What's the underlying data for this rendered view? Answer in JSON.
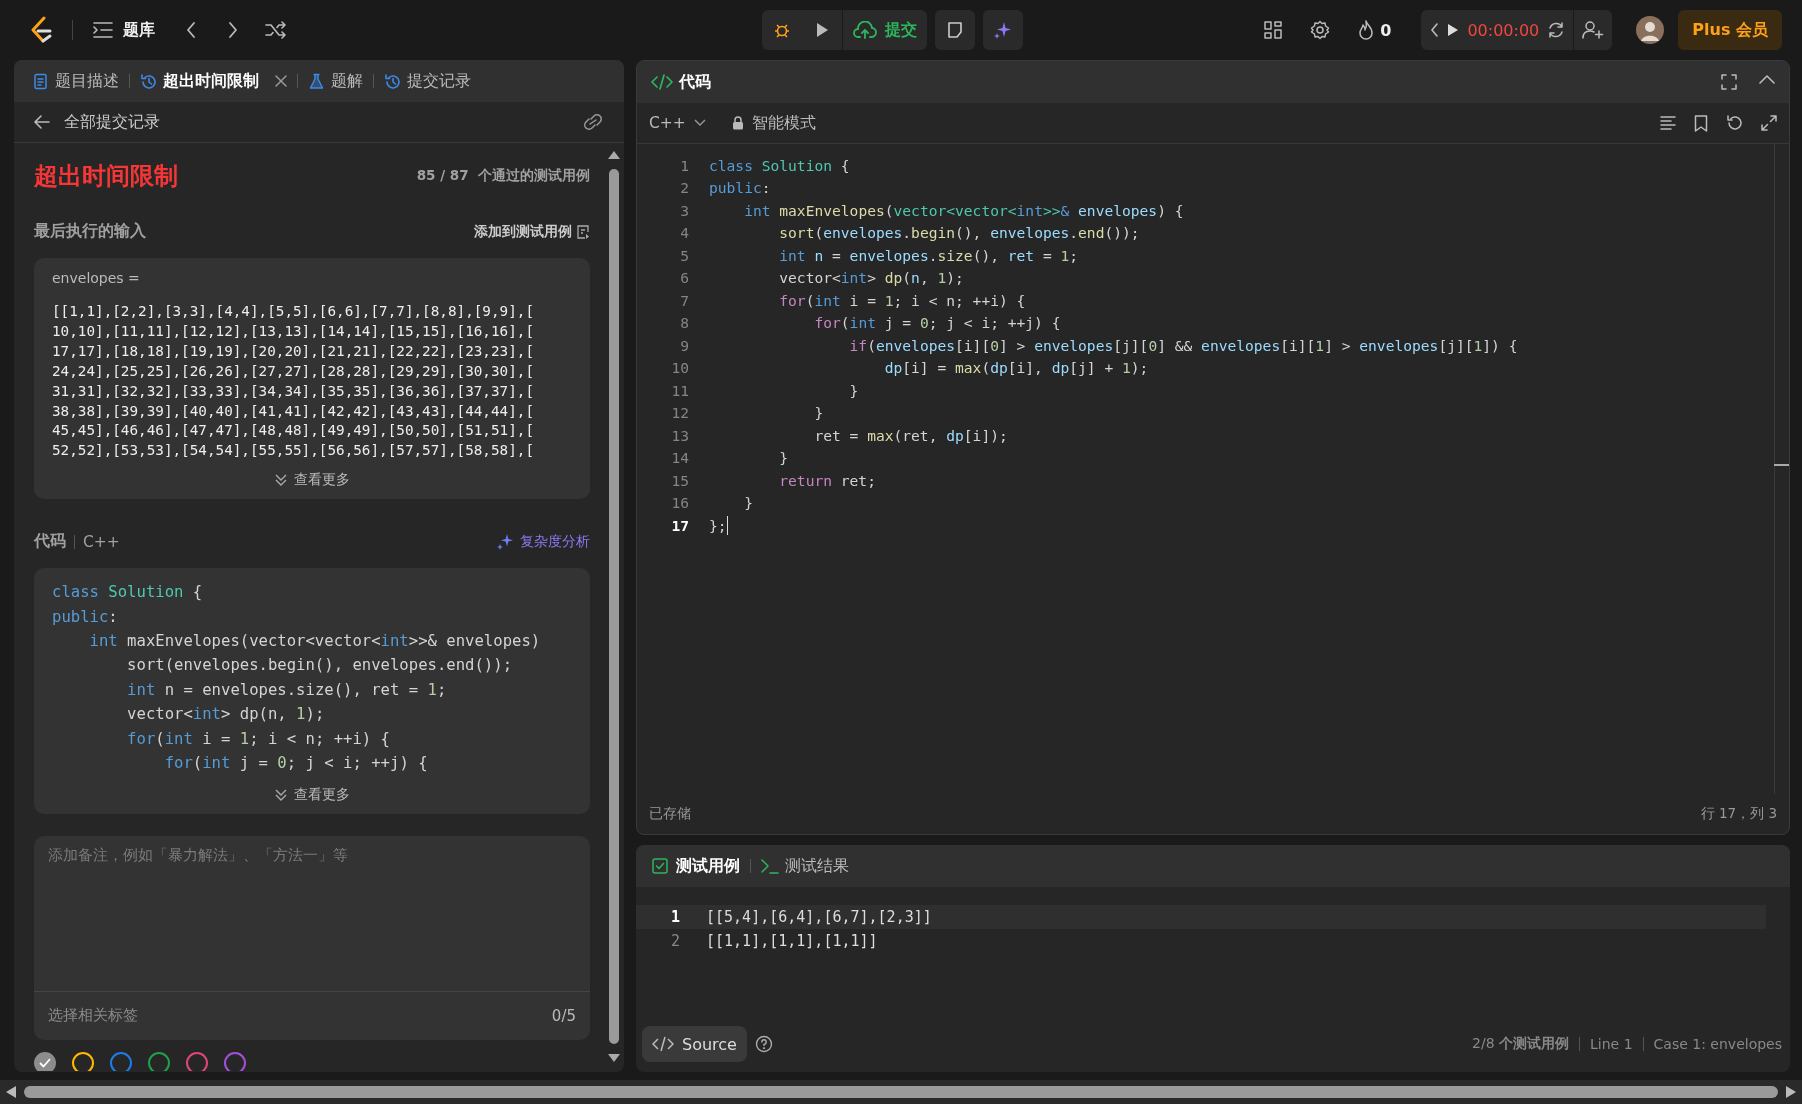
{
  "topbar": {
    "library": "题库",
    "submit": "提交",
    "streak": "0",
    "timer": "00:00:00",
    "plus": "Plus 会员"
  },
  "left_panel": {
    "tabs": [
      {
        "label": "题目描述",
        "kind": "description",
        "selected": false,
        "closable": false
      },
      {
        "label": "超出时间限制",
        "kind": "submission",
        "selected": true,
        "closable": true
      },
      {
        "label": "题解",
        "kind": "solution",
        "selected": false,
        "closable": false
      },
      {
        "label": "提交记录",
        "kind": "history",
        "selected": false,
        "closable": false
      }
    ],
    "back": "全部提交记录",
    "status": "超出时间限制",
    "passed": "85 / 87",
    "passed_label": "个通过的测试用例",
    "last_input_label": "最后执行的输入",
    "add_to_tests": "添加到测试用例",
    "input_name": "envelopes =",
    "input_lines": [
      "[[1,1],[2,2],[3,3],[4,4],[5,5],[6,6],[7,7],[8,8],[9,9],[",
      "10,10],[11,11],[12,12],[13,13],[14,14],[15,15],[16,16],[",
      "17,17],[18,18],[19,19],[20,20],[21,21],[22,22],[23,23],[",
      "24,24],[25,25],[26,26],[27,27],[28,28],[29,29],[30,30],[",
      "31,31],[32,32],[33,33],[34,34],[35,35],[36,36],[37,37],[",
      "38,38],[39,39],[40,40],[41,41],[42,42],[43,43],[44,44],[",
      "45,45],[46,46],[47,47],[48,48],[49,49],[50,50],[51,51],[",
      "52,52],[53,53],[54,54],[55,55],[56,56],[57,57],[58,58],["
    ],
    "show_more": "查看更多",
    "code_label": "代码",
    "code_lang": "C++",
    "complexity": "复杂度分析",
    "code_preview": [
      [
        {
          "kind": "kw",
          "text": "class "
        },
        {
          "kind": "type",
          "text": "Solution"
        },
        {
          "kind": "txt",
          "text": " {"
        }
      ],
      [
        {
          "kind": "kw",
          "text": "public"
        },
        {
          "kind": "txt",
          "text": ":"
        }
      ],
      [
        {
          "kind": "kw",
          "text": "    int"
        },
        {
          "kind": "txt",
          "text": " maxEnvelopes(vector<vector<"
        },
        {
          "kind": "kw",
          "text": "int"
        },
        {
          "kind": "txt",
          "text": ">>& envelopes)"
        }
      ],
      [
        {
          "kind": "txt",
          "text": "        sort(envelopes.begin(), envelopes.end());"
        }
      ],
      [
        {
          "kind": "kw",
          "text": "        int"
        },
        {
          "kind": "txt",
          "text": " n = envelopes.size(), ret = "
        },
        {
          "kind": "num",
          "text": "1"
        },
        {
          "kind": "txt",
          "text": ";"
        }
      ],
      [
        {
          "kind": "txt",
          "text": "        vector<"
        },
        {
          "kind": "kw",
          "text": "int"
        },
        {
          "kind": "txt",
          "text": "> dp(n, "
        },
        {
          "kind": "num",
          "text": "1"
        },
        {
          "kind": "txt",
          "text": ");"
        }
      ],
      [
        {
          "kind": "kw",
          "text": "        for"
        },
        {
          "kind": "txt",
          "text": "("
        },
        {
          "kind": "kw",
          "text": "int"
        },
        {
          "kind": "txt",
          "text": " i = "
        },
        {
          "kind": "num",
          "text": "1"
        },
        {
          "kind": "txt",
          "text": "; i < n; ++i) {"
        }
      ],
      [
        {
          "kind": "kw",
          "text": "            for"
        },
        {
          "kind": "txt",
          "text": "("
        },
        {
          "kind": "kw",
          "text": "int"
        },
        {
          "kind": "txt",
          "text": " j = "
        },
        {
          "kind": "num",
          "text": "0"
        },
        {
          "kind": "txt",
          "text": "; j < i; ++j) {"
        }
      ]
    ],
    "show_more_code": "查看更多",
    "note_placeholder": "添加备注，例如「暴力解法」、「方法一」等",
    "tags_placeholder": "选择相关标签",
    "tags_count": "0/5",
    "colors": [
      {
        "color": "#8c8c8c",
        "selected": true
      },
      {
        "color": "#ffb800",
        "selected": false
      },
      {
        "color": "#1e7ce8",
        "selected": false
      },
      {
        "color": "#1fa14a",
        "selected": false
      },
      {
        "color": "#e0457b",
        "selected": false
      },
      {
        "color": "#a54fd8",
        "selected": false
      }
    ]
  },
  "editor": {
    "title": "代码",
    "language": "C++",
    "mode": "智能模式",
    "lines": [
      {
        "no": "1",
        "current": false,
        "tokens": [
          {
            "kind": "kw",
            "text": "class "
          },
          {
            "kind": "type",
            "text": "Solution"
          },
          {
            "kind": "txt",
            "text": " {"
          }
        ]
      },
      {
        "no": "2",
        "current": false,
        "tokens": [
          {
            "kind": "kw",
            "text": "public"
          },
          {
            "kind": "txt",
            "text": ":"
          }
        ]
      },
      {
        "no": "3",
        "current": false,
        "tokens": [
          {
            "kind": "kw",
            "text": "    int"
          },
          {
            "kind": "fn",
            "text": " maxEnvelopes"
          },
          {
            "kind": "txt",
            "text": "("
          },
          {
            "kind": "type",
            "text": "vector<vector<"
          },
          {
            "kind": "kw",
            "text": "int"
          },
          {
            "kind": "type",
            "text": ">>"
          },
          {
            "kind": "kw",
            "text": "& "
          },
          {
            "kind": "var",
            "text": "envelopes"
          },
          {
            "kind": "txt",
            "text": ") {"
          }
        ]
      },
      {
        "no": "4",
        "current": false,
        "tokens": [
          {
            "kind": "fn",
            "text": "        sort"
          },
          {
            "kind": "txt",
            "text": "("
          },
          {
            "kind": "var",
            "text": "envelopes"
          },
          {
            "kind": "txt",
            "text": "."
          },
          {
            "kind": "fn",
            "text": "begin"
          },
          {
            "kind": "txt",
            "text": "(), "
          },
          {
            "kind": "var",
            "text": "envelopes"
          },
          {
            "kind": "txt",
            "text": "."
          },
          {
            "kind": "fn",
            "text": "end"
          },
          {
            "kind": "txt",
            "text": "());"
          }
        ]
      },
      {
        "no": "5",
        "current": false,
        "tokens": [
          {
            "kind": "kw",
            "text": "        int"
          },
          {
            "kind": "var",
            "text": " n"
          },
          {
            "kind": "txt",
            "text": " = "
          },
          {
            "kind": "var",
            "text": "envelopes"
          },
          {
            "kind": "txt",
            "text": "."
          },
          {
            "kind": "fn",
            "text": "size"
          },
          {
            "kind": "txt",
            "text": "(), "
          },
          {
            "kind": "var",
            "text": "ret"
          },
          {
            "kind": "txt",
            "text": " = "
          },
          {
            "kind": "num",
            "text": "1"
          },
          {
            "kind": "txt",
            "text": ";"
          }
        ]
      },
      {
        "no": "6",
        "current": false,
        "tokens": [
          {
            "kind": "txt",
            "text": "        vector<"
          },
          {
            "kind": "kw",
            "text": "int"
          },
          {
            "kind": "txt",
            "text": "> "
          },
          {
            "kind": "fn",
            "text": "dp"
          },
          {
            "kind": "txt",
            "text": "("
          },
          {
            "kind": "var",
            "text": "n"
          },
          {
            "kind": "txt",
            "text": ", "
          },
          {
            "kind": "num",
            "text": "1"
          },
          {
            "kind": "txt",
            "text": ");"
          }
        ]
      },
      {
        "no": "7",
        "current": false,
        "tokens": [
          {
            "kind": "ctl",
            "text": "        for"
          },
          {
            "kind": "txt",
            "text": "("
          },
          {
            "kind": "kw",
            "text": "int"
          },
          {
            "kind": "txt",
            "text": " i = "
          },
          {
            "kind": "num",
            "text": "1"
          },
          {
            "kind": "txt",
            "text": "; i < n; ++i) {"
          }
        ]
      },
      {
        "no": "8",
        "current": false,
        "tokens": [
          {
            "kind": "ctl",
            "text": "            for"
          },
          {
            "kind": "txt",
            "text": "("
          },
          {
            "kind": "kw",
            "text": "int"
          },
          {
            "kind": "txt",
            "text": " j = "
          },
          {
            "kind": "num",
            "text": "0"
          },
          {
            "kind": "txt",
            "text": "; j < i; ++j) {"
          }
        ]
      },
      {
        "no": "9",
        "current": false,
        "tokens": [
          {
            "kind": "ctl",
            "text": "                if"
          },
          {
            "kind": "txt",
            "text": "("
          },
          {
            "kind": "var",
            "text": "envelopes"
          },
          {
            "kind": "txt",
            "text": "[i]["
          },
          {
            "kind": "num",
            "text": "0"
          },
          {
            "kind": "txt",
            "text": "] > "
          },
          {
            "kind": "var",
            "text": "envelopes"
          },
          {
            "kind": "txt",
            "text": "[j]["
          },
          {
            "kind": "num",
            "text": "0"
          },
          {
            "kind": "txt",
            "text": "] && "
          },
          {
            "kind": "var",
            "text": "envelopes"
          },
          {
            "kind": "txt",
            "text": "[i]["
          },
          {
            "kind": "num",
            "text": "1"
          },
          {
            "kind": "txt",
            "text": "] > "
          },
          {
            "kind": "var",
            "text": "envelopes"
          },
          {
            "kind": "txt",
            "text": "[j]["
          },
          {
            "kind": "num",
            "text": "1"
          },
          {
            "kind": "txt",
            "text": "]) {"
          }
        ]
      },
      {
        "no": "10",
        "current": false,
        "tokens": [
          {
            "kind": "var",
            "text": "                    dp"
          },
          {
            "kind": "txt",
            "text": "[i] = "
          },
          {
            "kind": "fn",
            "text": "max"
          },
          {
            "kind": "txt",
            "text": "("
          },
          {
            "kind": "var",
            "text": "dp"
          },
          {
            "kind": "txt",
            "text": "[i], "
          },
          {
            "kind": "var",
            "text": "dp"
          },
          {
            "kind": "txt",
            "text": "[j] + "
          },
          {
            "kind": "num",
            "text": "1"
          },
          {
            "kind": "txt",
            "text": ");"
          }
        ]
      },
      {
        "no": "11",
        "current": false,
        "tokens": [
          {
            "kind": "txt",
            "text": "                }"
          }
        ]
      },
      {
        "no": "12",
        "current": false,
        "tokens": [
          {
            "kind": "txt",
            "text": "            }"
          }
        ]
      },
      {
        "no": "13",
        "current": false,
        "tokens": [
          {
            "kind": "txt",
            "text": "            ret = "
          },
          {
            "kind": "fn",
            "text": "max"
          },
          {
            "kind": "txt",
            "text": "(ret, "
          },
          {
            "kind": "var",
            "text": "dp"
          },
          {
            "kind": "txt",
            "text": "[i]);"
          }
        ]
      },
      {
        "no": "14",
        "current": false,
        "tokens": [
          {
            "kind": "txt",
            "text": "        }"
          }
        ]
      },
      {
        "no": "15",
        "current": false,
        "tokens": [
          {
            "kind": "ctl",
            "text": "        return"
          },
          {
            "kind": "txt",
            "text": " ret;"
          }
        ]
      },
      {
        "no": "16",
        "current": false,
        "tokens": [
          {
            "kind": "txt",
            "text": "    }"
          }
        ]
      },
      {
        "no": "17",
        "current": true,
        "tokens": [
          {
            "kind": "txt",
            "text": "};"
          }
        ]
      }
    ],
    "saved": "已存储",
    "position": "行 17，列 3"
  },
  "tests": {
    "tabs": [
      {
        "label": "测试用例",
        "kind": "cases",
        "selected": true
      },
      {
        "label": "测试结果",
        "kind": "result",
        "selected": false
      }
    ],
    "lines": [
      {
        "no": "1",
        "text": "[[5,4],[6,4],[6,7],[2,3]]",
        "current": true
      },
      {
        "no": "2",
        "text": "[[1,1],[1,1],[1,1]]",
        "current": false
      }
    ],
    "source": "Source",
    "count": "2/8",
    "count_label": "个测试用例",
    "line": "Line 1",
    "case": "Case 1: envelopes"
  }
}
